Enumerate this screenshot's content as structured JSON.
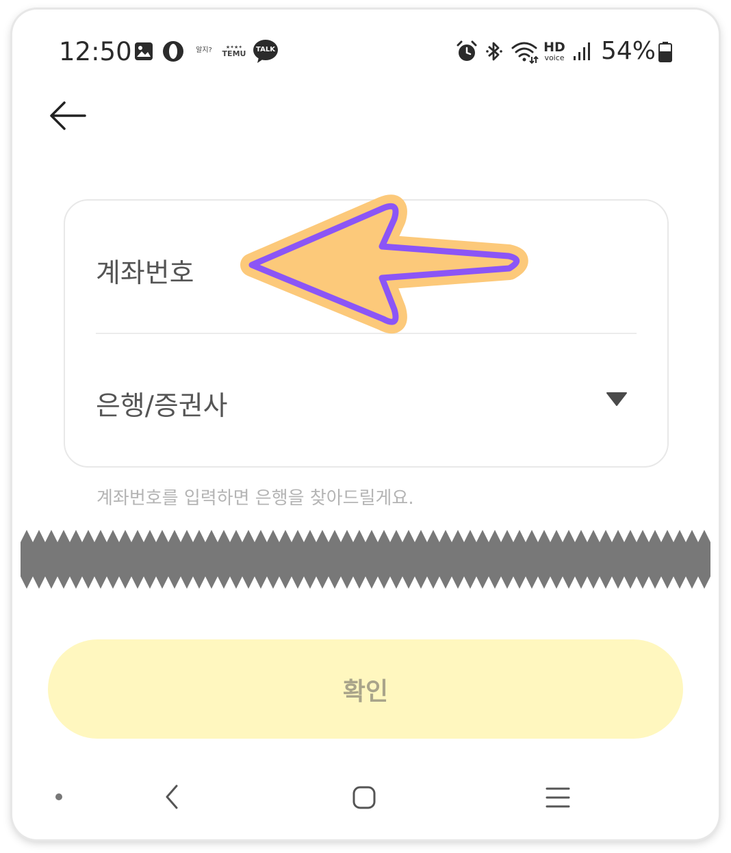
{
  "status_bar": {
    "time": "12:50",
    "battery_percent": "54%",
    "icons": [
      "gallery-icon",
      "opera-icon",
      "alzi-app-icon",
      "temu-app-icon",
      "kakaotalk-icon",
      "alarm-icon",
      "bluetooth-icon",
      "wifi-icon",
      "hd-voice-icon",
      "signal-icon",
      "battery-icon"
    ],
    "mini_texts": {
      "alzi": "알지?",
      "temu": "TEMU",
      "talk": "TALK",
      "hd": "HD",
      "voice": "voice"
    }
  },
  "form": {
    "account_number_placeholder": "계좌번호",
    "bank_placeholder": "은행/증권사",
    "helper_text": "계좌번호를 입력하면 은행을 찾아드릴게요."
  },
  "confirm_button": {
    "label": "확인"
  },
  "colors": {
    "confirm_bg": "#fff7bf",
    "confirm_text": "#a9a48a",
    "annotation_arrow_fill": "#fcc97a",
    "annotation_arrow_stroke": "#8b55f6",
    "torn_band": "#787878"
  }
}
